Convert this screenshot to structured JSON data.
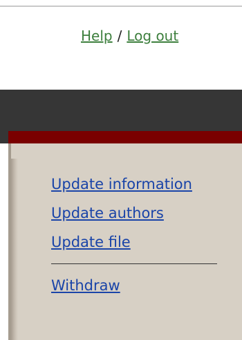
{
  "header": {
    "help_label": "Help",
    "separator": "/",
    "logout_label": "Log out"
  },
  "actions": {
    "update_information": "Update information",
    "update_authors": "Update authors",
    "update_file": "Update file",
    "withdraw": "Withdraw"
  },
  "colors": {
    "link_green": "#3d7f3d",
    "link_blue": "#1a44a8",
    "dark_bar": "#363636",
    "accent_red": "#7a0000",
    "panel_bg": "#d7d0c5"
  }
}
